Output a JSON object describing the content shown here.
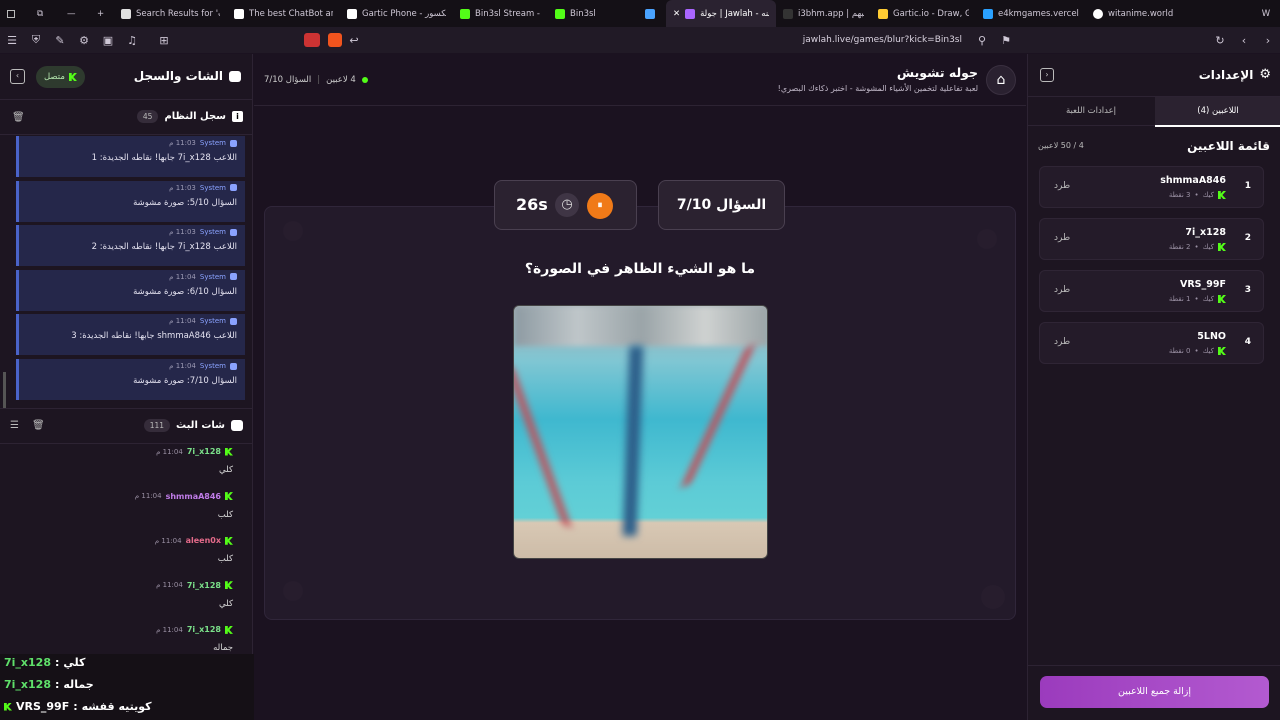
{
  "browser": {
    "tabs": [
      {
        "label": "Search Results for 'بحرب",
        "color": "#e0e0e0"
      },
      {
        "label": "The best ChatBot and",
        "color": "#ffffff"
      },
      {
        "label": "Gartic Phone - المكسور",
        "color": "#ffffff"
      },
      {
        "label": "Bin3sl Stream - Watch",
        "color": "#53fc18"
      },
      {
        "label": "Bin3sl",
        "color": "#53fc18"
      },
      {
        "label": "",
        "color": "#4aa3ff"
      },
      {
        "label": "جولة | Jawlah - منه",
        "color": "#aa66ff"
      },
      {
        "label": "i3bhm.app | لعبهم",
        "color": "#333"
      },
      {
        "label": "Gartic.io - Draw, Guess",
        "color": "#ffcc33"
      },
      {
        "label": "e4kmgames.vercel.app",
        "color": "#2aa1ff"
      },
      {
        "label": "witanime.world",
        "color": "#ffffff"
      }
    ],
    "url": "jawlah.live/games/blur?kick=Bin3sl"
  },
  "left": {
    "title": "الشات والسجل",
    "status": "متصل",
    "system_log": {
      "title": "سجل النظام",
      "count": "45",
      "items": [
        {
          "sender": "System",
          "time": "11:03 م",
          "text": "اللاعب 7i_x128 جابها! نقاطه الجديدة: 1"
        },
        {
          "sender": "System",
          "time": "11:03 م",
          "text": "السؤال 5/10: صورة مشوشة"
        },
        {
          "sender": "System",
          "time": "11:03 م",
          "text": "اللاعب 7i_x128 جابها! نقاطه الجديدة: 2"
        },
        {
          "sender": "System",
          "time": "11:04 م",
          "text": "السؤال 6/10: صورة مشوشة"
        },
        {
          "sender": "System",
          "time": "11:04 م",
          "text": "اللاعب shmmaA846 جابها! نقاطه الجديدة: 3"
        },
        {
          "sender": "System",
          "time": "11:04 م",
          "text": "السؤال 7/10: صورة مشوشة"
        }
      ]
    },
    "stream_chat": {
      "title": "شات البث",
      "count": "111",
      "messages": [
        {
          "user": "7i_x128",
          "time": "11:04 م",
          "text": "كلي",
          "color": "#7be08a"
        },
        {
          "user": "shmmaA846",
          "time": "11:04 م",
          "text": "كلب",
          "color": "#c07ce8"
        },
        {
          "user": "aleen0x",
          "time": "11:04 م",
          "text": "كلب",
          "color": "#e46a8a"
        },
        {
          "user": "7i_x128",
          "time": "11:04 م",
          "text": "كلي",
          "color": "#7be08a"
        },
        {
          "user": "7i_x128",
          "time": "11:04 م",
          "text": "جماله",
          "color": "#7be08a"
        },
        {
          "user": "VRS_99F",
          "time": "11:04 م",
          "text": "كويتيه قفشه",
          "color": "#c9c3d0"
        }
      ]
    },
    "overlay": [
      {
        "user": "7i_x128",
        "text": "كلي",
        "color": "#5fe06a"
      },
      {
        "user": "7i_x128",
        "text": "جماله",
        "color": "#5fe06a"
      },
      {
        "user": "VRS_99F",
        "text": "كويتيه قفشه",
        "color": "#ffffff"
      }
    ]
  },
  "game": {
    "title": "جوله تشويش",
    "subtitle": "لعبة تفاعلية لتخمين الأشياء المشوشة - اختبر ذكاءك البصري!",
    "players_online": "4 لاعبين",
    "question_short": "السؤال 7/10",
    "question_label": "السؤال 7/10",
    "timer": "26s",
    "prompt": "ما هو الشيء الظاهر في الصورة؟"
  },
  "settings": {
    "title": "الإعدادات",
    "tabs": [
      "اللاعبين (4)",
      "إعدادات اللعبة"
    ],
    "list_title": "قائمة اللاعبين",
    "capacity": "4 / 50 لاعبين",
    "kick_label": "طرد",
    "players": [
      {
        "rank": "1",
        "name": "shmmaA846",
        "points": "3 نقطة",
        "platform": "كيك"
      },
      {
        "rank": "2",
        "name": "7i_x128",
        "points": "2 نقطة",
        "platform": "كيك"
      },
      {
        "rank": "3",
        "name": "VRS_99F",
        "points": "1 نقطة",
        "platform": "كيك"
      },
      {
        "rank": "4",
        "name": "5LNO",
        "points": "0 نقطة",
        "platform": "كيك"
      }
    ],
    "remove_all": "إزالة جميع اللاعبين"
  }
}
